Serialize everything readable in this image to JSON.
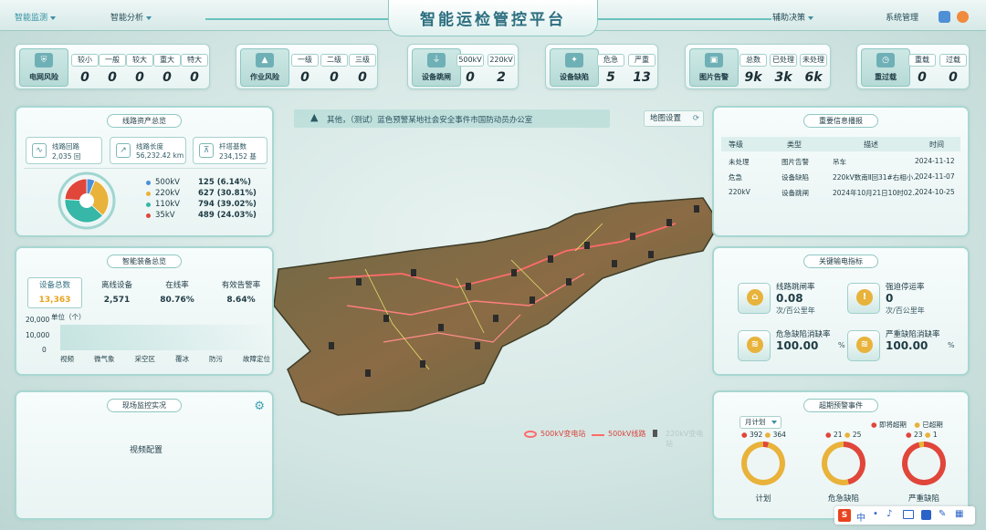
{
  "nav": {
    "left": [
      "智能监测",
      "智能分析"
    ],
    "right": [
      "辅助决策",
      "系统管理"
    ],
    "title": "智能运检管控平台"
  },
  "stats": [
    {
      "label": "电网风险",
      "cols": [
        {
          "k": "较小",
          "v": "0"
        },
        {
          "k": "一般",
          "v": "0"
        },
        {
          "k": "较大",
          "v": "0"
        },
        {
          "k": "重大",
          "v": "0"
        },
        {
          "k": "特大",
          "v": "0"
        }
      ]
    },
    {
      "label": "作业风险",
      "cols": [
        {
          "k": "一级",
          "v": "0"
        },
        {
          "k": "二级",
          "v": "0"
        },
        {
          "k": "三级",
          "v": "0"
        }
      ]
    },
    {
      "label": "设备跳闸",
      "cols": [
        {
          "k": "500kV",
          "v": "0"
        },
        {
          "k": "220kV",
          "v": "2"
        }
      ]
    },
    {
      "label": "设备缺陷",
      "cols": [
        {
          "k": "危急",
          "v": "5"
        },
        {
          "k": "严重",
          "v": "13"
        }
      ]
    },
    {
      "label": "图片告警",
      "cols": [
        {
          "k": "总数",
          "v": "9k"
        },
        {
          "k": "已处理",
          "v": "3k"
        },
        {
          "k": "未处理",
          "v": "6k"
        }
      ]
    },
    {
      "label": "重过载",
      "cols": [
        {
          "k": "重载",
          "v": "0"
        },
        {
          "k": "过载",
          "v": "0"
        }
      ]
    }
  ],
  "assets": {
    "title": "线路资产总览",
    "boxes": [
      {
        "t": "线路回路",
        "n": "2,035 回"
      },
      {
        "t": "线路长度",
        "n": "56,232.42 km"
      },
      {
        "t": "杆塔基数",
        "n": "234,152 基"
      }
    ],
    "legend": [
      {
        "name": "500kV",
        "value": "125 (6.14%)",
        "color": "#4a90d9"
      },
      {
        "name": "220kV",
        "value": "627 (30.81%)",
        "color": "#e9b23a"
      },
      {
        "name": "110kV",
        "value": "794 (39.02%)",
        "color": "#36b7a7"
      },
      {
        "name": "35kV",
        "value": "489 (24.03%)",
        "color": "#e0463a"
      }
    ]
  },
  "equipment": {
    "title": "智能装备总览",
    "headers": [
      "设备总数",
      "离线设备",
      "在线率",
      "有效告警率"
    ],
    "values": [
      "13,363",
      "2,571",
      "80.76%",
      "8.64%"
    ],
    "yticks": [
      "20,000",
      "10,000",
      "0"
    ],
    "unit": "单位（个）",
    "categories": [
      "视频",
      "微气象",
      "采空区",
      "覆冰",
      "防污",
      "故障定位"
    ]
  },
  "monitor": {
    "title": "现场监控实况",
    "placeholder": "视频配置"
  },
  "alert_banner": "其他，（测试）蓝色预警某地社会安全事件市国防动员办公室",
  "map_button": "地图设置",
  "map_legend": [
    "500kV变电站",
    "500kV线路",
    "220kV变电站"
  ],
  "info": {
    "title": "重要信息播报",
    "headers": [
      "等级",
      "类型",
      "描述",
      "时间"
    ],
    "rows": [
      [
        "未处理",
        "图片告警",
        "吊车",
        "2024-11-12"
      ],
      [
        "危急",
        "设备缺陷",
        "220kV数南Ⅱ回31#右相小...",
        "2024-11-07"
      ],
      [
        "220kV",
        "设备跳闸",
        "2024年10月21日10时02...",
        "2024-10-25"
      ]
    ]
  },
  "kpis": {
    "title": "关键输电指标",
    "items": [
      {
        "name": "线路跳闸率",
        "value": "0.08",
        "unit": "次/百公里年",
        "icon": "⌂"
      },
      {
        "name": "强迫停运率",
        "value": "0",
        "unit": "次/百公里年",
        "icon": "!"
      },
      {
        "name": "危急缺陷消缺率",
        "value": "100.00",
        "unit": "%",
        "icon": "≋"
      },
      {
        "name": "严重缺陷消缺率",
        "value": "100.00",
        "unit": "%",
        "icon": "≋"
      }
    ]
  },
  "overdue": {
    "title": "超期预警事件",
    "select": "月计划",
    "legend": [
      "即将超期",
      "已超期"
    ],
    "rings": [
      {
        "label": "计划",
        "a": "392",
        "b": "364"
      },
      {
        "label": "危急缺陷",
        "a": "21",
        "b": "25"
      },
      {
        "label": "严重缺陷",
        "a": "23",
        "b": "1"
      }
    ]
  },
  "ime": [
    "中"
  ]
}
